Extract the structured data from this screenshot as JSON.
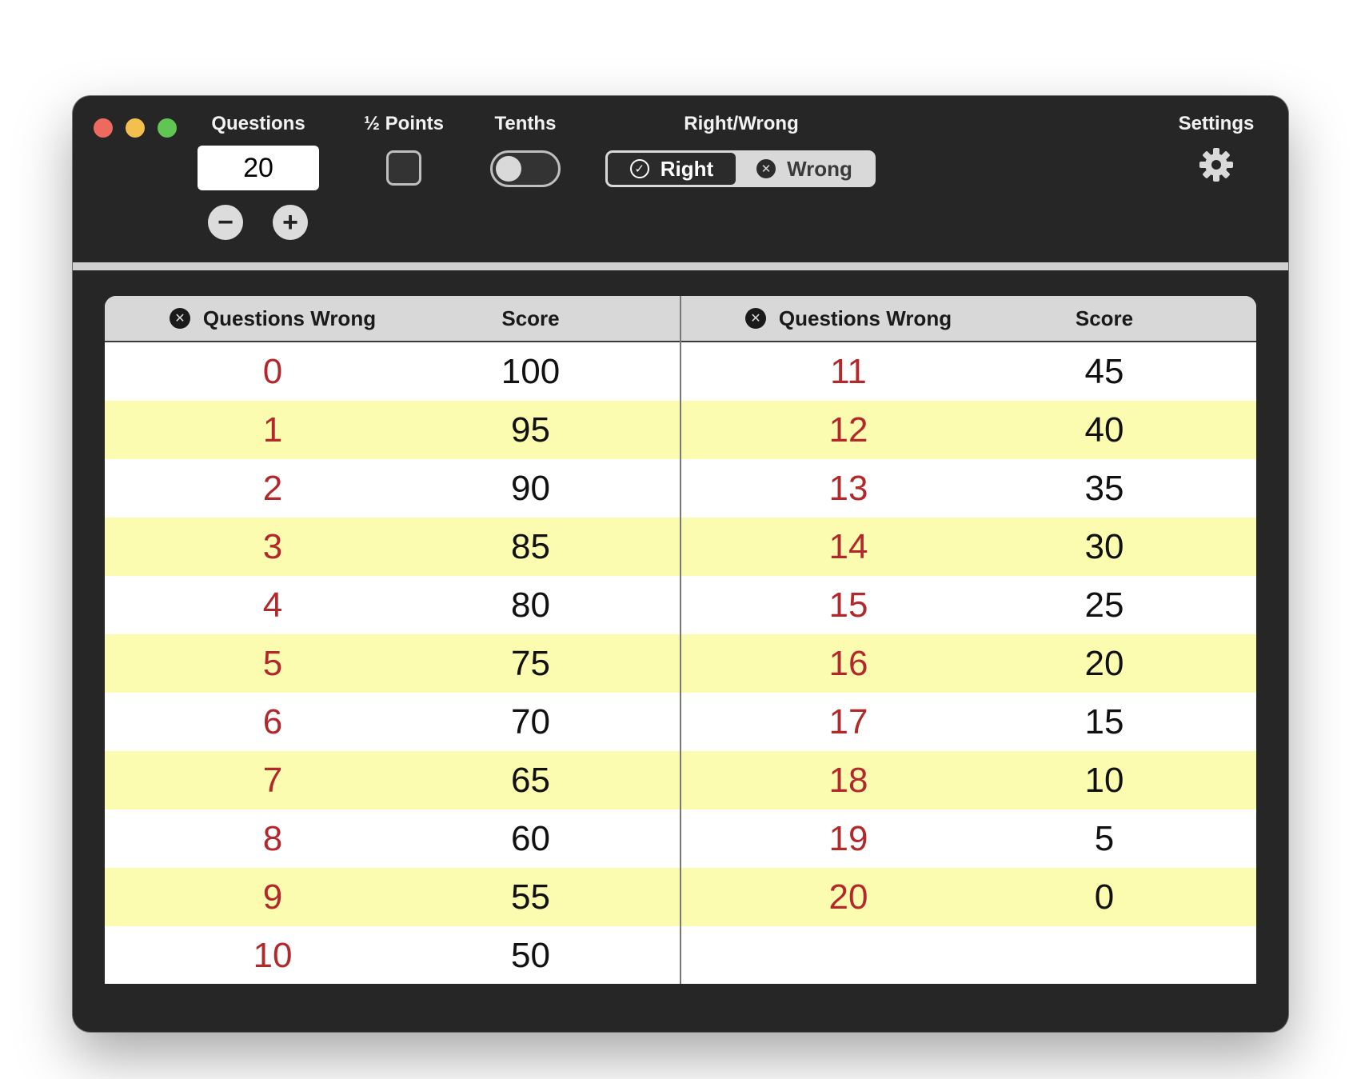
{
  "window": {
    "controls": [
      "close",
      "minimize",
      "maximize"
    ]
  },
  "toolbar": {
    "questions_label": "Questions",
    "questions_value": "20",
    "decrement_symbol": "−",
    "increment_symbol": "+",
    "half_points_label": "½ Points",
    "half_points_checked": false,
    "tenths_label": "Tenths",
    "tenths_on": false,
    "right_wrong_label": "Right/Wrong",
    "right_option": "Right",
    "wrong_option": "Wrong",
    "selected_mode": "Right",
    "right_icon": "✓",
    "wrong_icon": "✕",
    "settings_label": "Settings",
    "settings_icon": "gear-icon"
  },
  "table": {
    "header_icon": "✕",
    "col_wrong": "Questions Wrong",
    "col_score": "Score",
    "left": [
      {
        "wrong": "0",
        "score": "100"
      },
      {
        "wrong": "1",
        "score": "95"
      },
      {
        "wrong": "2",
        "score": "90"
      },
      {
        "wrong": "3",
        "score": "85"
      },
      {
        "wrong": "4",
        "score": "80"
      },
      {
        "wrong": "5",
        "score": "75"
      },
      {
        "wrong": "6",
        "score": "70"
      },
      {
        "wrong": "7",
        "score": "65"
      },
      {
        "wrong": "8",
        "score": "60"
      },
      {
        "wrong": "9",
        "score": "55"
      },
      {
        "wrong": "10",
        "score": "50"
      }
    ],
    "right": [
      {
        "wrong": "11",
        "score": "45"
      },
      {
        "wrong": "12",
        "score": "40"
      },
      {
        "wrong": "13",
        "score": "35"
      },
      {
        "wrong": "14",
        "score": "30"
      },
      {
        "wrong": "15",
        "score": "25"
      },
      {
        "wrong": "16",
        "score": "20"
      },
      {
        "wrong": "17",
        "score": "15"
      },
      {
        "wrong": "18",
        "score": "10"
      },
      {
        "wrong": "19",
        "score": "5"
      },
      {
        "wrong": "20",
        "score": "0"
      }
    ]
  },
  "colors": {
    "wrong_text": "#b3282b",
    "alt_row": "#fbfcb0",
    "window_bg": "#262626"
  }
}
